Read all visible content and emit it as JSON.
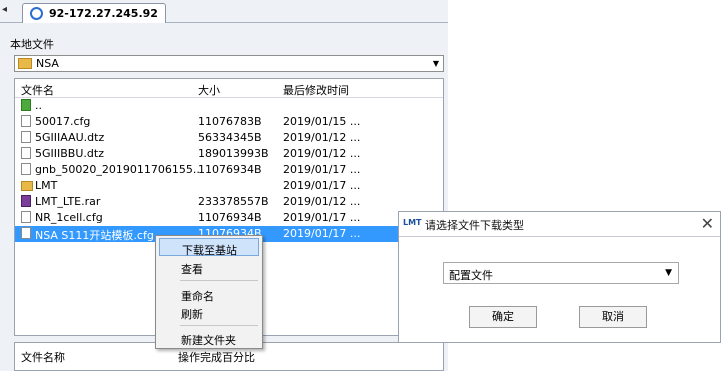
{
  "tab": {
    "title": "92-172.27.245.92",
    "arrow": "◂"
  },
  "local": {
    "title": "本地文件",
    "path": "NSA"
  },
  "filelist": {
    "headers": {
      "name": "文件名",
      "size": "大小",
      "modified": "最后修改时间"
    },
    "rows": [
      {
        "name": "..",
        "size": "",
        "date": "",
        "icon": "up-folder-icon"
      },
      {
        "name": "50017.cfg",
        "size": "11076783B",
        "date": "2019/01/15 ...",
        "icon": "file-icon"
      },
      {
        "name": "5GIIIAAU.dtz",
        "size": "56334345B",
        "date": "2019/01/12 ...",
        "icon": "file-icon"
      },
      {
        "name": "5GIIIBBU.dtz",
        "size": "189013993B",
        "date": "2019/01/12 ...",
        "icon": "file-icon"
      },
      {
        "name": "gnb_50020_2019011706155...",
        "size": "11076934B",
        "date": "2019/01/17 ...",
        "icon": "file-icon"
      },
      {
        "name": "LMT",
        "size": "",
        "date": "2019/01/17 ...",
        "icon": "folder-icon"
      },
      {
        "name": "LMT_LTE.rar",
        "size": "233378557B",
        "date": "2019/01/12 ...",
        "icon": "rar-icon"
      },
      {
        "name": "NR_1cell.cfg",
        "size": "11076934B",
        "date": "2019/01/17 ...",
        "icon": "file-icon"
      },
      {
        "name": "NSA S111开站模板.cfg",
        "size": "11076934B",
        "date": "2019/01/17 ...",
        "icon": "file-icon"
      }
    ]
  },
  "context_menu": {
    "items": [
      "下载至基站",
      "查看",
      "重命名",
      "刷新",
      "新建文件夹"
    ]
  },
  "transfer": {
    "col_name": "文件名称",
    "col_progress": "操作完成百分比"
  },
  "dialog": {
    "logo": "LMT",
    "title": "请选择文件下载类型",
    "close": "✕",
    "selected": "配置文件",
    "ok": "确定",
    "cancel": "取消"
  }
}
